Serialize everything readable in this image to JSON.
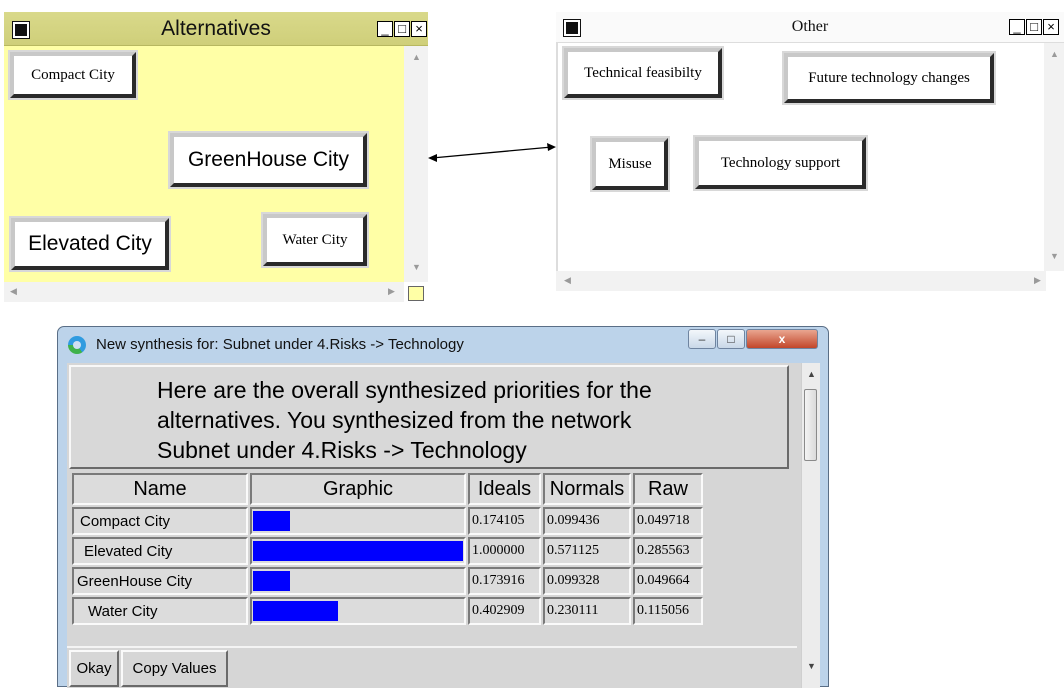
{
  "alternatives_window": {
    "title": "Alternatives",
    "nodes": [
      "Compact City",
      "GreenHouse City",
      "Elevated City",
      "Water City"
    ],
    "controls": [
      "_",
      "□",
      "×"
    ]
  },
  "other_window": {
    "title": "Other",
    "nodes": [
      "Technical feasibilty",
      "Future technology changes",
      "Misuse",
      "Technology support"
    ],
    "controls": [
      "_",
      "□",
      "×"
    ]
  },
  "dialog": {
    "title": "New synthesis for: Subnet under 4.Risks -> Technology",
    "controls": [
      "–",
      "□",
      "x"
    ],
    "message": [
      "Here are the overall synthesized priorities for the",
      "alternatives.  You synthesized from the network",
      "Subnet under 4.Risks -> Technology"
    ],
    "columns": [
      "Name",
      "Graphic",
      "Ideals",
      "Normals",
      "Raw"
    ],
    "rows": [
      {
        "name": "Compact City",
        "ideal": "0.174105",
        "normal": "0.099436",
        "raw": "0.049718",
        "bar": 0.174105
      },
      {
        "name": "Elevated City",
        "ideal": "1.000000",
        "normal": "0.571125",
        "raw": "0.285563",
        "bar": 1.0
      },
      {
        "name": "GreenHouse City",
        "ideal": "0.173916",
        "normal": "0.099328",
        "raw": "0.049664",
        "bar": 0.173916
      },
      {
        "name": "Water City",
        "ideal": "0.402909",
        "normal": "0.230111",
        "raw": "0.115056",
        "bar": 0.402909
      }
    ],
    "buttons": [
      "Okay",
      "Copy Values"
    ],
    "bar_color": "#0000ff"
  },
  "colors": {
    "alternatives_bg": "#ffffa6",
    "alternatives_title": "#d4d480"
  }
}
